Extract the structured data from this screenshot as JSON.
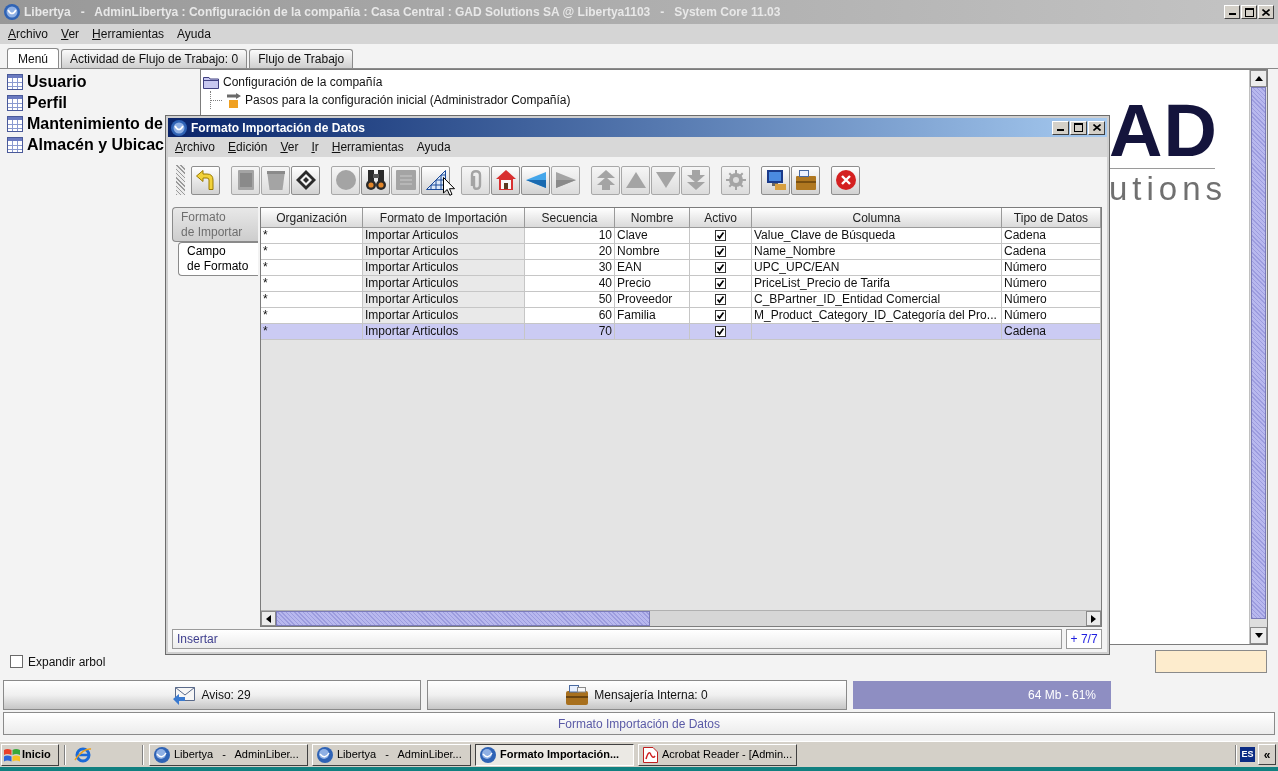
{
  "window": {
    "title": "Libertya   -   AdminLibertya : Configuración de la compañía : Casa Central : GAD Solutions SA @ Libertya1103   -   System Core 11.03"
  },
  "menu": [
    {
      "label": "Archivo",
      "mnemonic": true
    },
    {
      "label": "Ver",
      "mnemonic": true
    },
    {
      "label": "Herramientas",
      "mnemonic": true
    },
    {
      "label": "Ayuda",
      "mnemonic": false
    }
  ],
  "tabs": [
    {
      "label": "Menú",
      "selected": true
    },
    {
      "label": "Actividad de Flujo de Trabajo: 0",
      "selected": false
    },
    {
      "label": "Flujo de Trabajo",
      "selected": false
    }
  ],
  "favorites": [
    "Usuario",
    "Perfil",
    "Mantenimiento de",
    "Almacén y Ubicac"
  ],
  "menu_tree": [
    {
      "label": "Configuración de la compañía",
      "kind": "folder",
      "children": [
        {
          "label": "Pasos para la configuración inicial (Administrador Compañía)",
          "kind": "process"
        }
      ]
    }
  ],
  "logo": {
    "mark": "AD",
    "tagline": "utions"
  },
  "expand_tree": {
    "label": "Expandir arbol",
    "checked": false
  },
  "status_buttons": [
    {
      "label": "Aviso: 29",
      "kind": "notice"
    },
    {
      "label": "Mensajería Interna: 0",
      "kind": "messages"
    },
    {
      "label": "64 Mb - 61%",
      "kind": "memory"
    }
  ],
  "status_line": "Formato Importación de Datos",
  "dialog": {
    "title": "Formato Importación de Datos",
    "menu": [
      {
        "label": "Archivo",
        "mnemonic": true
      },
      {
        "label": "Edición",
        "mnemonic": true
      },
      {
        "label": "Ver",
        "mnemonic": true
      },
      {
        "label": "Ir",
        "mnemonic": true
      },
      {
        "label": "Herramientas",
        "mnemonic": true
      },
      {
        "label": "Ayuda",
        "mnemonic": false
      }
    ],
    "toolbar": [
      [
        {
          "disabled": false
        }
      ],
      [
        {
          "disabled": true
        },
        {
          "disabled": true
        },
        {
          "disabled": false
        }
      ],
      [
        {
          "disabled": true
        },
        {
          "disabled": false
        },
        {
          "disabled": true
        },
        {
          "disabled": false
        }
      ],
      [
        {
          "disabled": true
        },
        {
          "disabled": false
        },
        {
          "disabled": false
        },
        {
          "disabled": true
        }
      ],
      [
        {
          "disabled": true
        },
        {
          "disabled": true
        },
        {
          "disabled": true
        },
        {
          "disabled": true
        }
      ],
      [
        {
          "disabled": true
        }
      ],
      [
        {
          "disabled": false
        },
        {
          "disabled": false
        }
      ],
      [
        {
          "disabled": false
        }
      ]
    ],
    "tabs": [
      {
        "label": "Formato de Importar",
        "selected": false
      },
      {
        "label": "Campo de Formato",
        "selected": true
      }
    ],
    "table": {
      "columns": [
        {
          "label": "Organización",
          "kind": "text"
        },
        {
          "label": "Formato de Importación",
          "kind": "readonly"
        },
        {
          "label": "Secuencia",
          "kind": "number"
        },
        {
          "label": "Nombre",
          "kind": "text"
        },
        {
          "label": "Activo",
          "kind": "check"
        },
        {
          "label": "Columna",
          "kind": "text"
        },
        {
          "label": "Tipo de Datos",
          "kind": "text"
        }
      ],
      "rows": [
        {
          "organization": "*",
          "import_format": "Importar Articulos",
          "sequence": "10",
          "name": "Clave",
          "active": true,
          "column": "Value_Clave de Búsqueda",
          "data_type": "Cadena",
          "selected": false
        },
        {
          "organization": "*",
          "import_format": "Importar Articulos",
          "sequence": "20",
          "name": "Nombre",
          "active": true,
          "column": "Name_Nombre",
          "data_type": "Cadena",
          "selected": false
        },
        {
          "organization": "*",
          "import_format": "Importar Articulos",
          "sequence": "30",
          "name": "EAN",
          "active": true,
          "column": "UPC_UPC/EAN",
          "data_type": "Número",
          "selected": false
        },
        {
          "organization": "*",
          "import_format": "Importar Articulos",
          "sequence": "40",
          "name": "Precio",
          "active": true,
          "column": "PriceList_Precio de Tarifa",
          "data_type": "Número",
          "selected": false
        },
        {
          "organization": "*",
          "import_format": "Importar Articulos",
          "sequence": "50",
          "name": "Proveedor",
          "active": true,
          "column": "C_BPartner_ID_Entidad Comercial",
          "data_type": "Número",
          "selected": false
        },
        {
          "organization": "*",
          "import_format": "Importar Articulos",
          "sequence": "60",
          "name": "Familia",
          "active": true,
          "column": "M_Product_Category_ID_Categoría del Pro...",
          "data_type": "Número",
          "selected": false
        },
        {
          "organization": "*",
          "import_format": "Importar Articulos",
          "sequence": "70",
          "active": true,
          "data_type": "Cadena",
          "selected": true
        }
      ]
    },
    "status": "Insertar",
    "record_count": "+ 7/7"
  },
  "taskbar": {
    "start": "Inicio",
    "tasks": [
      {
        "label": "Libertya   -   AdminLiber...",
        "kind": "app",
        "selected": false
      },
      {
        "label": "Libertya   -   AdminLiber...",
        "kind": "app",
        "selected": false
      },
      {
        "label": "Formato Importación...",
        "kind": "app",
        "selected": true
      },
      {
        "label": "Acrobat Reader - [Admin...",
        "kind": "pdf",
        "selected": false
      }
    ],
    "language": "ES",
    "show_hidden": "«"
  }
}
